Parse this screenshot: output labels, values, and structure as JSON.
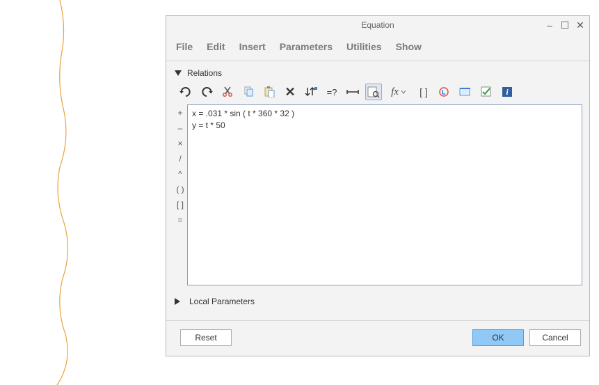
{
  "window": {
    "title": "Equation"
  },
  "menu": {
    "file": "File",
    "edit": "Edit",
    "insert": "Insert",
    "parameters": "Parameters",
    "utilities": "Utilities",
    "show": "Show"
  },
  "sections": {
    "relations": "Relations",
    "local_params": "Local Parameters"
  },
  "operators": {
    "plus": "+",
    "minus": "–",
    "times": "×",
    "divide": "/",
    "power": "^",
    "paren": "( )",
    "bracket": "[ ]",
    "equals": "="
  },
  "toolbar": {
    "undo": "undo",
    "redo": "redo",
    "cut": "cut",
    "copy": "copy",
    "paste": "paste",
    "delete": "delete",
    "sort": "sort",
    "eval": "=?",
    "measure": "measure",
    "find": "find",
    "fx": "fx",
    "brackets": "[ ]",
    "units": "units",
    "verify": "verify",
    "check": "check",
    "info": "info"
  },
  "equations": {
    "line1": "x = .031 * sin ( t * 360 * 32 )",
    "line2": "y = t * 50"
  },
  "footer": {
    "reset": "Reset",
    "ok": "OK",
    "cancel": "Cancel"
  }
}
